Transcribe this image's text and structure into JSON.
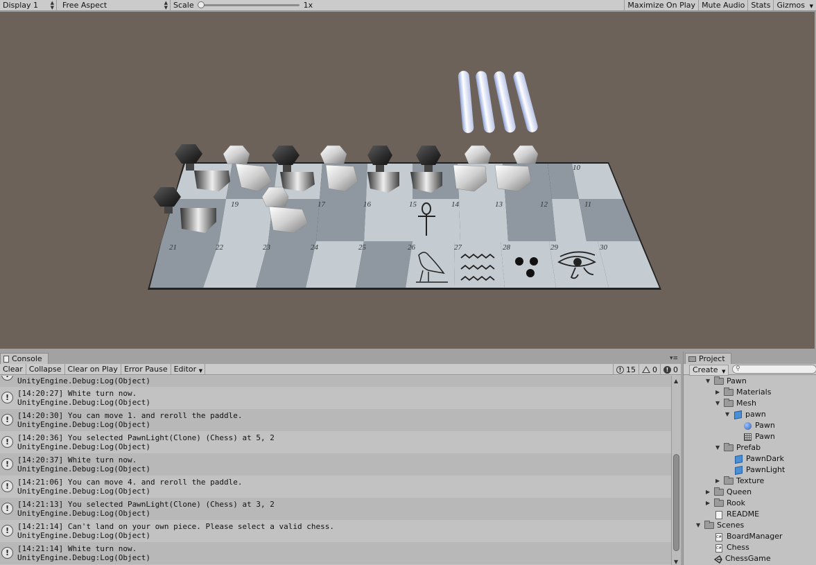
{
  "game_toolbar": {
    "display": "Display 1",
    "aspect": "Free Aspect",
    "scale_label": "Scale",
    "scale_value": "1x",
    "right_buttons": [
      "Maximize On Play",
      "Mute Audio",
      "Stats",
      "Gizmos"
    ]
  },
  "board": {
    "row_top_numbers": [
      "10"
    ],
    "row_mid_numbers": [
      "19",
      "17",
      "16",
      "15",
      "14",
      "13",
      "12",
      "11"
    ],
    "row_bottom_numbers": [
      "21",
      "22",
      "23",
      "24",
      "25",
      "26",
      "27",
      "28",
      "29",
      "30"
    ]
  },
  "console": {
    "tab_label": "Console",
    "toolbar": [
      "Clear",
      "Collapse",
      "Clear on Play",
      "Error Pause",
      "Editor"
    ],
    "counts": {
      "info": "15",
      "warnings": "0",
      "errors": "0"
    },
    "partial_top": "UnityEngine.Debug:Log(Object)",
    "logs": [
      {
        "message": "[14:20:27] White turn now.",
        "source": "UnityEngine.Debug:Log(Object)"
      },
      {
        "message": "[14:20:30] You can move 1. and reroll the paddle.",
        "source": "UnityEngine.Debug:Log(Object)"
      },
      {
        "message": "[14:20:36] You selected PawnLight(Clone) (Chess) at 5, 2",
        "source": "UnityEngine.Debug:Log(Object)"
      },
      {
        "message": "[14:20:37] White turn now.",
        "source": "UnityEngine.Debug:Log(Object)"
      },
      {
        "message": "[14:21:06] You can move 4. and reroll the paddle.",
        "source": "UnityEngine.Debug:Log(Object)"
      },
      {
        "message": "[14:21:13] You selected PawnLight(Clone) (Chess) at 3, 2",
        "source": "UnityEngine.Debug:Log(Object)"
      },
      {
        "message": "[14:21:14] Can't land on your own piece. Please select a valid chess.",
        "source": "UnityEngine.Debug:Log(Object)"
      },
      {
        "message": "[14:21:14] White turn now.",
        "source": "UnityEngine.Debug:Log(Object)"
      }
    ]
  },
  "project": {
    "tab_label": "Project",
    "create_label": "Create",
    "tree": [
      {
        "label": "Pawn",
        "type": "folder",
        "expanded": true
      },
      {
        "label": "Materials",
        "type": "folder",
        "expanded": false
      },
      {
        "label": "Mesh",
        "type": "folder",
        "expanded": true
      },
      {
        "label": "pawn",
        "type": "model",
        "expanded": true
      },
      {
        "label": "Pawn",
        "type": "sphere"
      },
      {
        "label": "Pawn",
        "type": "mesh"
      },
      {
        "label": "Prefab",
        "type": "folder",
        "expanded": true
      },
      {
        "label": "PawnDark",
        "type": "prefab"
      },
      {
        "label": "PawnLight",
        "type": "prefab"
      },
      {
        "label": "Texture",
        "type": "folder",
        "expanded": false
      },
      {
        "label": "Queen",
        "type": "folder",
        "expanded": false
      },
      {
        "label": "Rook",
        "type": "folder",
        "expanded": false
      },
      {
        "label": "README",
        "type": "doc"
      },
      {
        "label": "Scenes",
        "type": "folder",
        "expanded": true
      },
      {
        "label": "BoardManager",
        "type": "script"
      },
      {
        "label": "Chess",
        "type": "script"
      },
      {
        "label": "ChessGame",
        "type": "unity"
      }
    ]
  }
}
